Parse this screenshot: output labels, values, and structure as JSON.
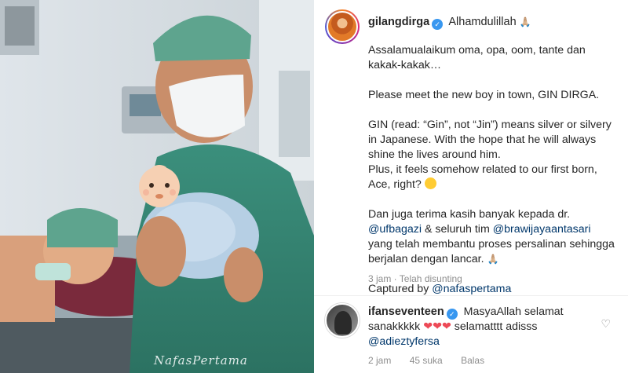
{
  "photo": {
    "watermark": "NafasPertama",
    "baby_emoji_icon": "baby-face-emoji"
  },
  "post": {
    "username": "gilangdirga",
    "first_line": "Alhamdulillah",
    "pray_emoji": "🙏🏼",
    "caption": {
      "p1": "Assalamualaikum oma, opa, oom, tante dan kakak-kakak…",
      "p2": "Please meet the new boy in town, GIN DIRGA.",
      "p3_a": "GIN (read: “Gin”, not “Jin”) means silver or silvery in Japanese. With the hope that he will always shine the lives around him.",
      "p3_b": "Plus, it feels somehow related to our first born, Ace, right?",
      "p4_a": "Dan juga terima kasih banyak kepada dr.",
      "p4_mention1": "@ufbagazi",
      "p4_b": " & seluruh tim ",
      "p4_mention2": "@brawijayaantasari",
      "p4_c": " yang telah membantu proses persalinan sehingga berjalan dengan lancar.",
      "p5_a": "Captured by ",
      "p5_mention": "@nafaspertama"
    },
    "meta": "3 jam · Telah disunting"
  },
  "comment": {
    "username": "ifanseventeen",
    "text_a": "MasyaAllah selamat sanakkkkk ",
    "hearts": "❤❤❤",
    "text_b": " selamatttt adisss ",
    "mention": "@adieztyfersa",
    "time": "2 jam",
    "likes": "45 suka",
    "reply": "Balas"
  },
  "colors": {
    "link": "#00376b",
    "verified": "#3897f0",
    "meta": "#8e8e8e",
    "heart": "#ed4956"
  }
}
